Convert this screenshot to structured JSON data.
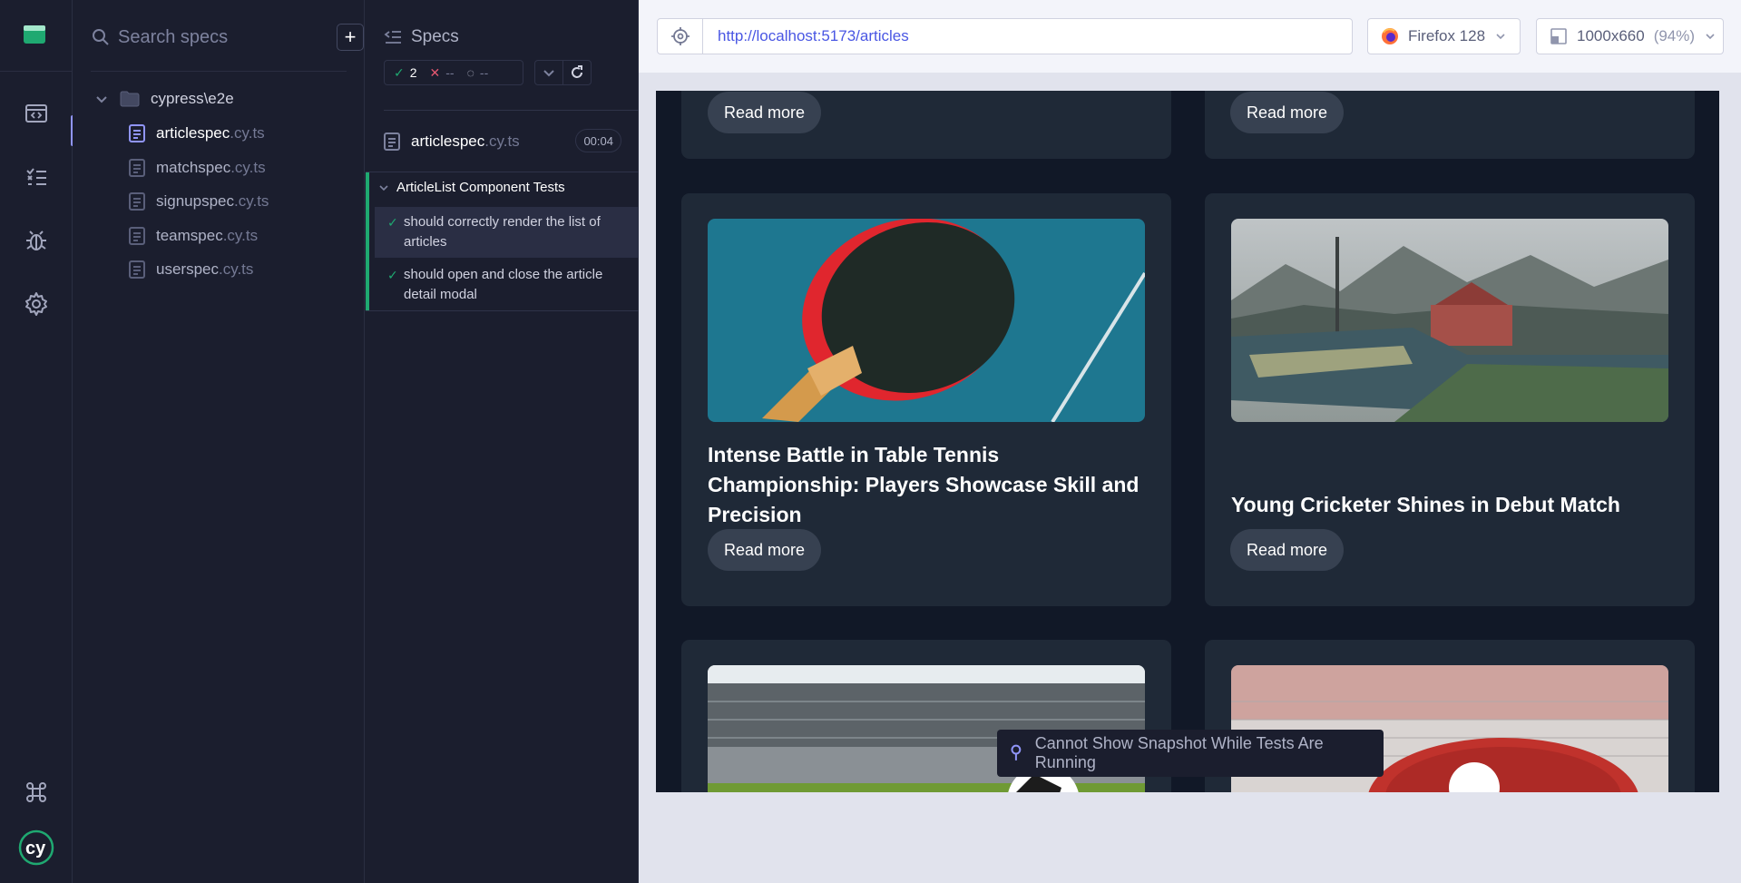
{
  "sidebar": {
    "nav": [
      {
        "name": "specs-nav",
        "icon": "code-window-icon"
      },
      {
        "name": "runs-nav",
        "icon": "test-list-icon"
      },
      {
        "name": "debug-nav",
        "icon": "bug-icon"
      },
      {
        "name": "settings-nav",
        "icon": "gear-icon"
      }
    ],
    "bottom": [
      {
        "name": "shortcuts-nav",
        "icon": "command-icon"
      },
      {
        "name": "cypress-logo",
        "icon": "cy-logo-icon"
      }
    ]
  },
  "specs_panel": {
    "search_placeholder": "Search specs",
    "add_label": "+",
    "folder": "cypress\\e2e",
    "files": [
      {
        "name": "articlespec",
        "ext": ".cy.ts",
        "active": true
      },
      {
        "name": "matchspec",
        "ext": ".cy.ts",
        "active": false
      },
      {
        "name": "signupspec",
        "ext": ".cy.ts",
        "active": false
      },
      {
        "name": "teamspec",
        "ext": ".cy.ts",
        "active": false
      },
      {
        "name": "userspec",
        "ext": ".cy.ts",
        "active": false
      }
    ]
  },
  "reporter": {
    "title": "Specs",
    "passed": "2",
    "failed": "--",
    "pending": "--",
    "file_name": "articlespec",
    "file_ext": ".cy.ts",
    "duration": "00:04",
    "suite_title": "ArticleList Component Tests",
    "tests": [
      {
        "title": "should correctly render the list of articles",
        "status": "passed"
      },
      {
        "title": "should open and close the article detail modal",
        "status": "passed"
      }
    ]
  },
  "preview": {
    "url": "http://localhost:5173/articles",
    "browser": "Firefox 128",
    "viewport": "1000x660",
    "zoom": "(94%)",
    "read_more": "Read more",
    "cards": [
      {
        "title": "Intense Battle in Table Tennis Championship: Players Showcase Skill and Precision",
        "image": "table-tennis-paddle"
      },
      {
        "title": "Young Cricketer Shines in Debut Match",
        "image": "cricket-stadium"
      }
    ],
    "tooltip": "Cannot Show Snapshot While Tests Are Running"
  },
  "colors": {
    "accent": "#9095f9",
    "pass": "#1fa971",
    "fail": "#e45770",
    "link": "#4956e3"
  }
}
